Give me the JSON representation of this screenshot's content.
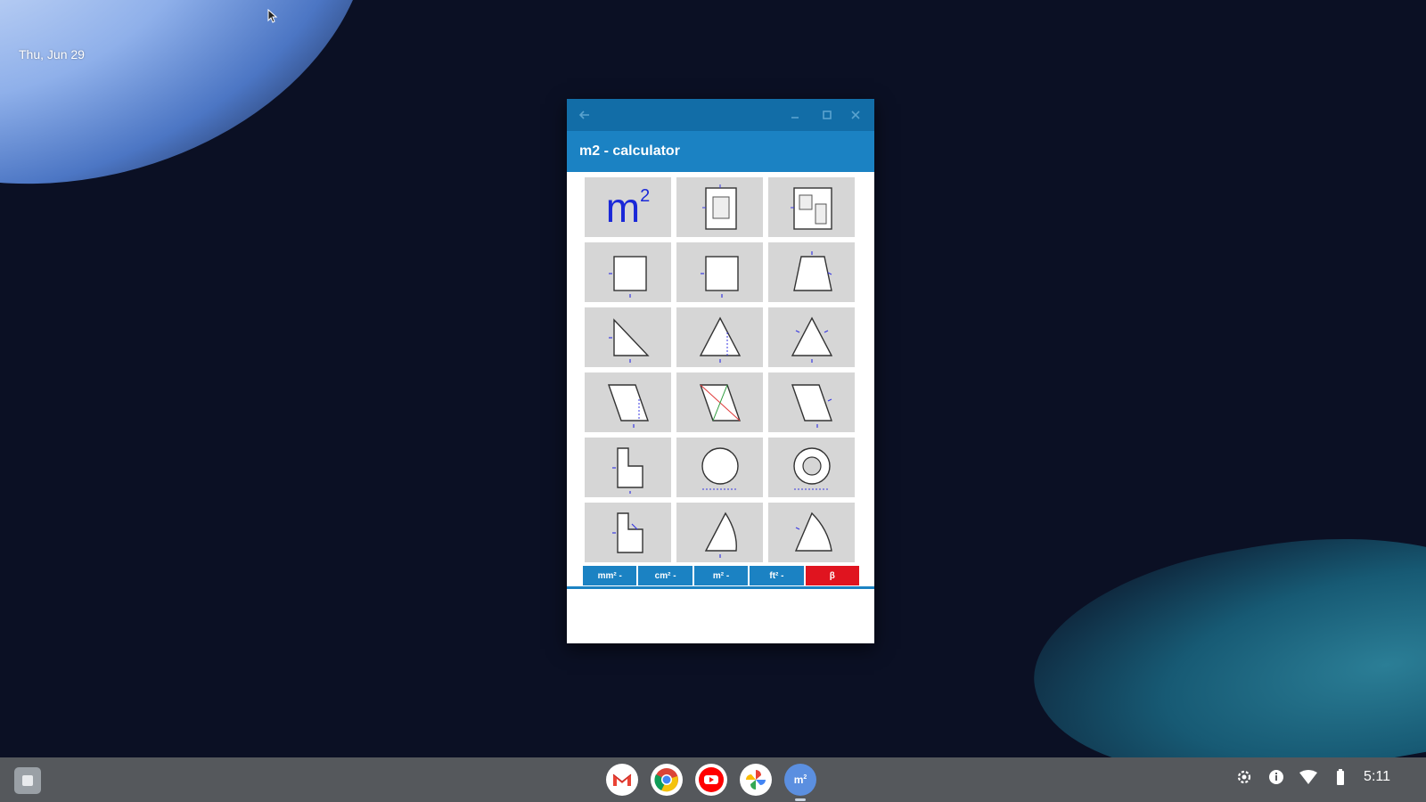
{
  "desktop": {
    "date": "Thu, Jun 29"
  },
  "window": {
    "title": "m2 - calculator",
    "caption_icons": [
      "back-arrow-icon",
      "minimize-icon",
      "maximize-icon",
      "close-icon"
    ]
  },
  "grid": {
    "logo_text": "m",
    "logo_sup": "2",
    "tiles": [
      "m2-logo",
      "room-area-icon",
      "multi-room-area-icon",
      "rectangle-icon",
      "square-icon",
      "trapezoid-icon",
      "right-triangle-icon",
      "triangle-height-icon",
      "triangle-sides-icon",
      "parallelogram-icon",
      "rhombus-icon",
      "parallelogram-sides-icon",
      "l-shape-icon",
      "circle-icon",
      "ring-icon",
      "l-shape-complex-icon",
      "circle-sector-icon",
      "circle-segment-icon"
    ]
  },
  "unit_bar": {
    "buttons": [
      {
        "label": "mm² -",
        "color": "#1b82c3"
      },
      {
        "label": "cm² -",
        "color": "#1b82c3"
      },
      {
        "label": "m² -",
        "color": "#1b82c3"
      },
      {
        "label": "ft² -",
        "color": "#1b82c3"
      },
      {
        "label": "β",
        "color": "#e0141f"
      }
    ]
  },
  "shelf": {
    "apps": [
      "gmail-icon",
      "chrome-icon",
      "youtube-icon",
      "photos-icon",
      "m2-calculator-icon"
    ],
    "tray_icons": [
      "settings-icon",
      "info-icon",
      "wifi-icon",
      "battery-icon"
    ],
    "time": "5:11"
  }
}
